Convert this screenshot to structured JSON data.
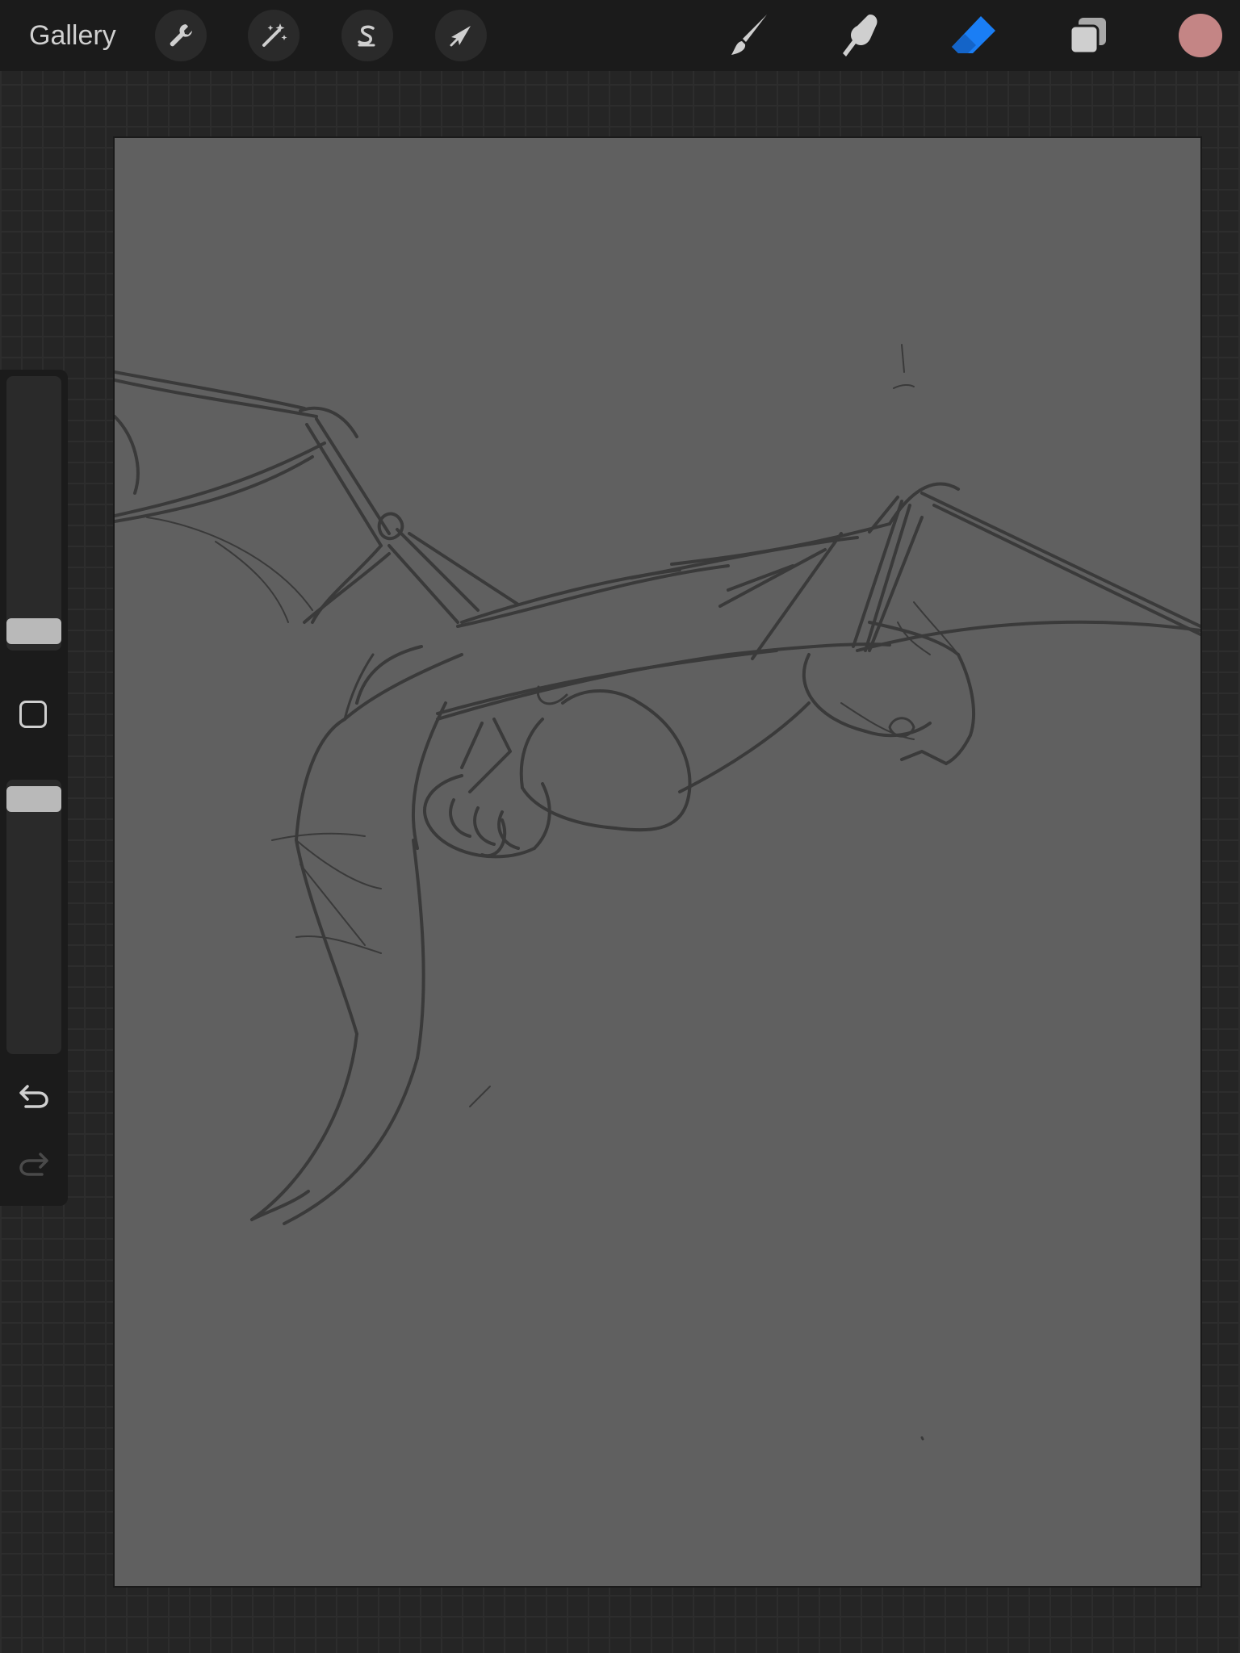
{
  "topbar": {
    "gallery_label": "Gallery",
    "left_tools": [
      {
        "name": "actions",
        "icon": "wrench-icon"
      },
      {
        "name": "adjustments",
        "icon": "magic-wand-icon"
      },
      {
        "name": "selection",
        "icon": "selection-s-icon"
      },
      {
        "name": "transform",
        "icon": "arrow-cursor-icon"
      }
    ],
    "right_tools": [
      {
        "name": "brush",
        "icon": "paintbrush-icon",
        "active": false
      },
      {
        "name": "smudge",
        "icon": "smudge-finger-icon",
        "active": false
      },
      {
        "name": "eraser",
        "icon": "eraser-icon",
        "active": true
      },
      {
        "name": "layers",
        "icon": "layers-icon",
        "active": false
      }
    ],
    "current_color": "#c48585"
  },
  "sidebar": {
    "brush_size_level": 0,
    "brush_opacity_level": 1,
    "modify_button_icon": "square-icon",
    "undo_icon": "undo-arrow-icon",
    "redo_icon": "redo-arrow-icon"
  },
  "colors": {
    "accent": "#1a7ef5",
    "canvas": "#606060",
    "sketch_stroke": "#3a3a3a",
    "toolbar": "#1b1b1b"
  },
  "canvas": {
    "content": "dragon-sketch"
  }
}
